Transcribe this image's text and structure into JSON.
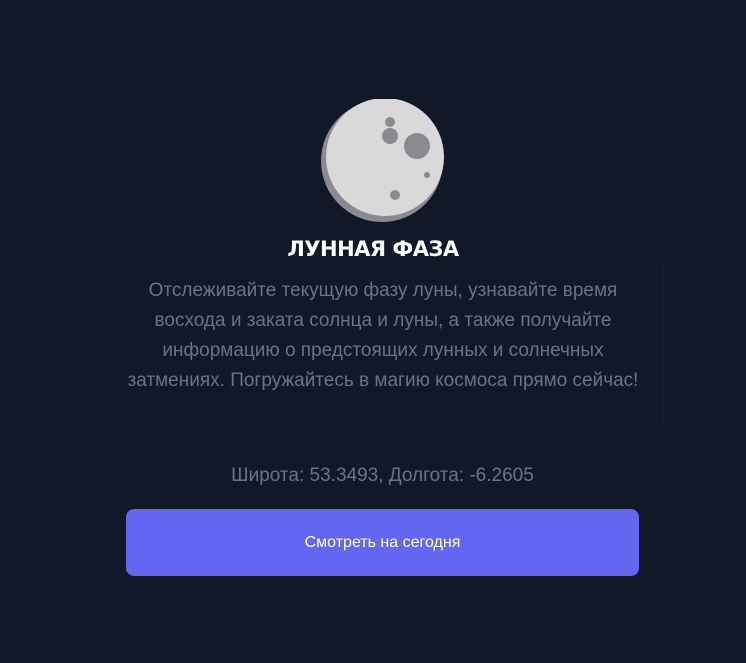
{
  "header": {
    "icon": "moon-icon",
    "title": "ЛУННАЯ ФАЗА"
  },
  "main": {
    "description": "Отслеживайте текущую фазу луны, узнавайте время восхода и заката солнца и луны, а также получайте информацию о предстоящих лунных и солнечных затмениях. Погружайтесь в магию космоса прямо сейчас!",
    "coordinates": "Широта: 53.3493, Долгота: -6.2605",
    "button_label": "Смотреть на сегодня"
  },
  "colors": {
    "background": "#121828",
    "accent": "#6366f1",
    "moon_light": "#d9d9d9",
    "moon_shadow": "#8a8a90"
  }
}
